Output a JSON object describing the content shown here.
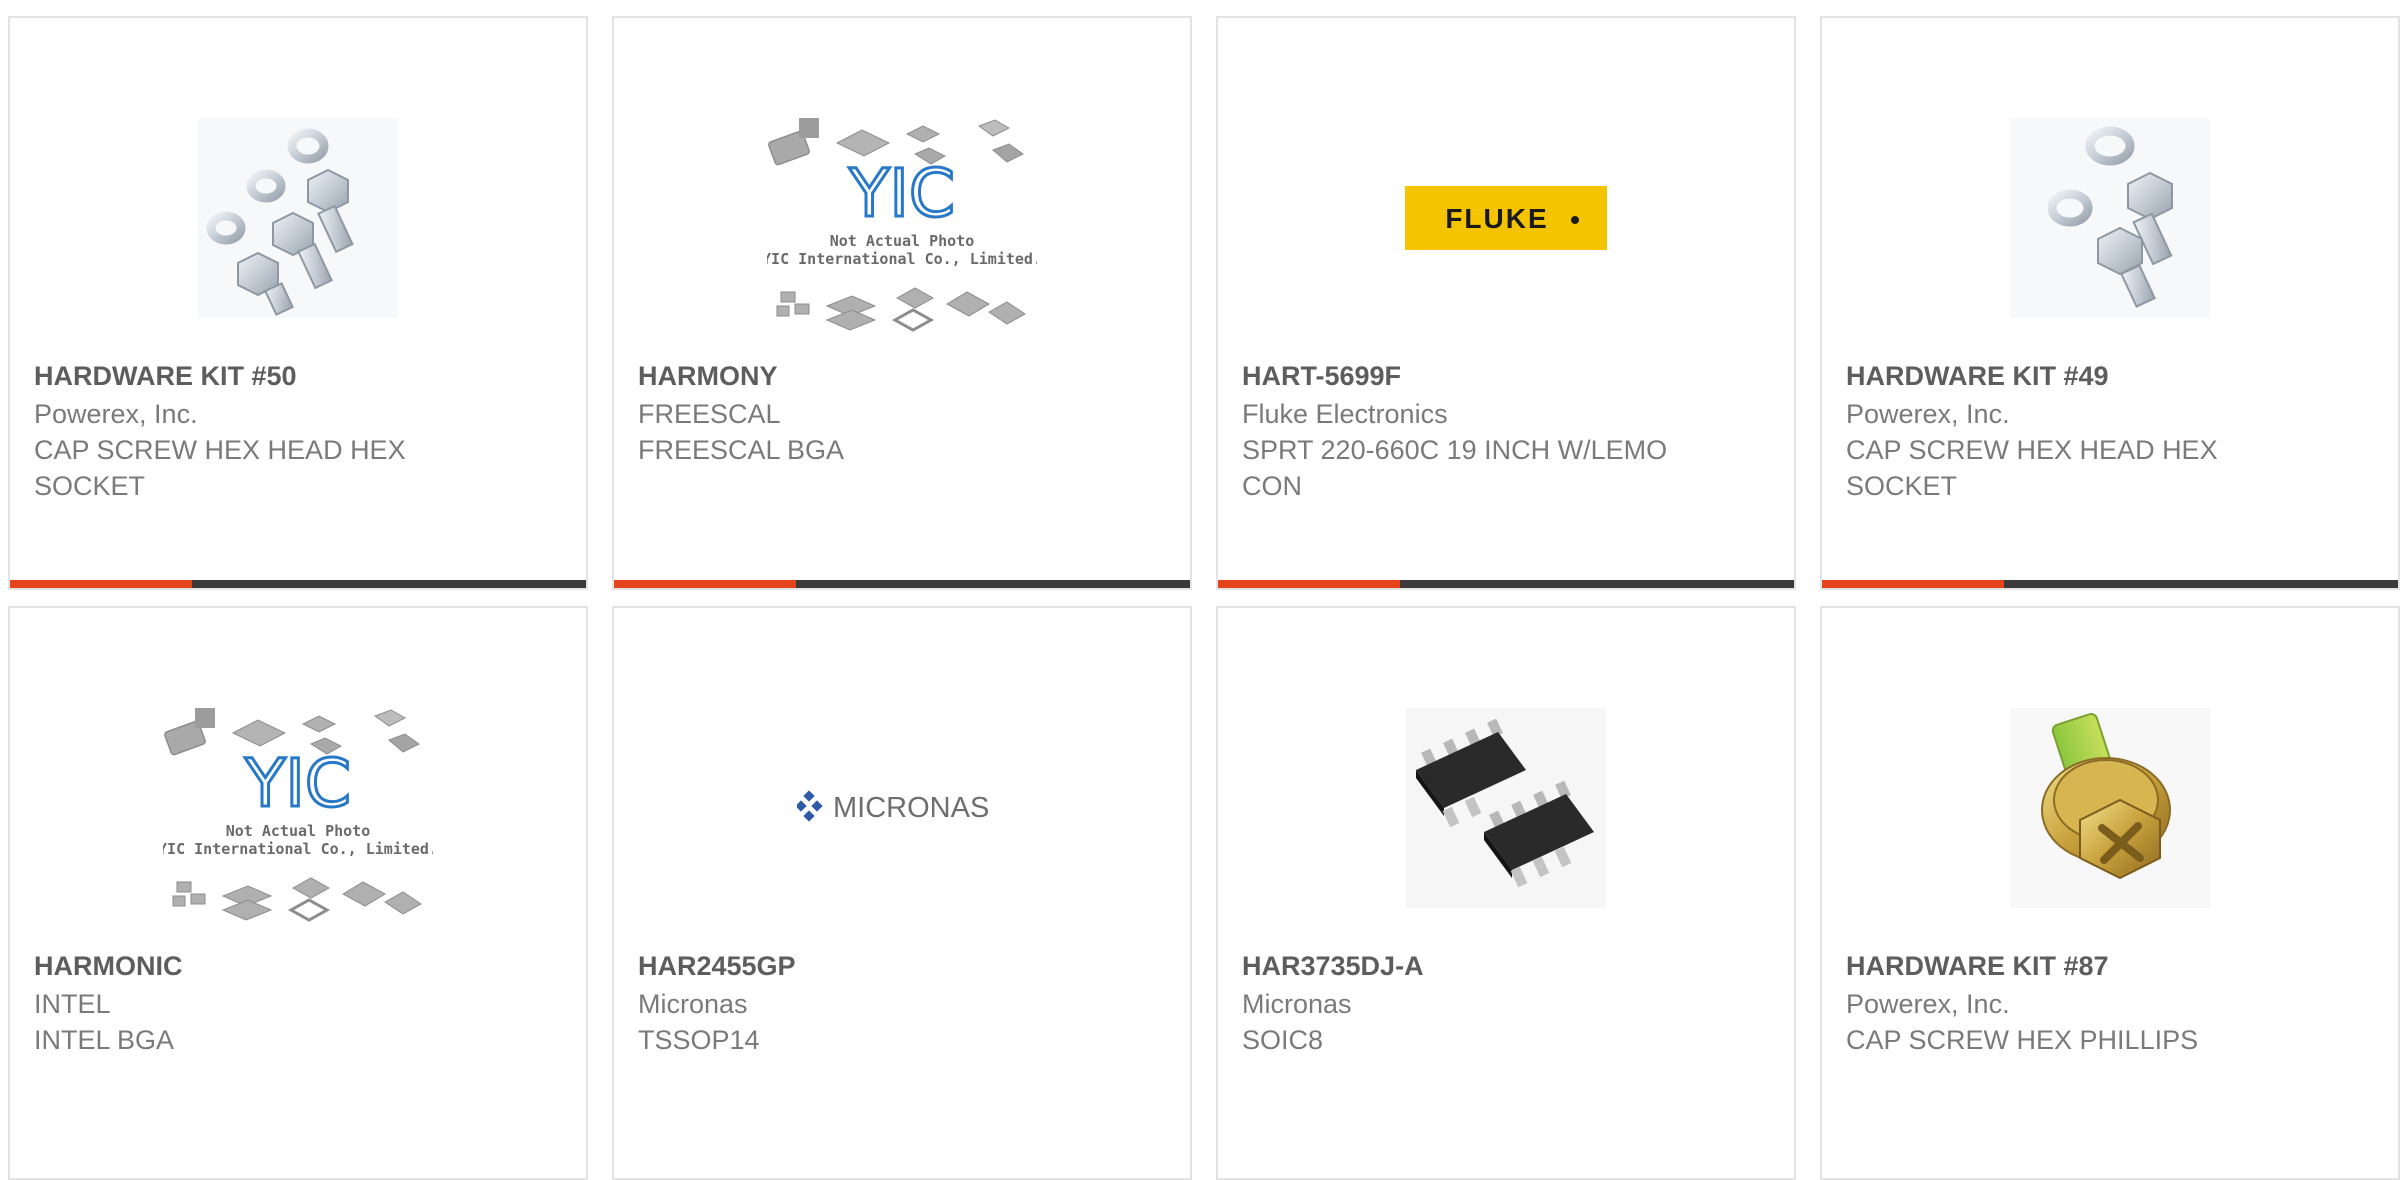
{
  "colors": {
    "accent": "#e5431b",
    "bar_dark": "#3a3a3a",
    "part_text": "#5d5d5d",
    "body_text": "#7a7a7a",
    "border": "#e3e3e3",
    "fluke_yellow": "#f5c400",
    "yic_blue": "#2878c8"
  },
  "placeholder": {
    "caption_line1": "Not Actual Photo",
    "caption_line2": "YIC International Co., Limited.",
    "logo_text": "YIC"
  },
  "logos": {
    "fluke": "FLUKE",
    "micronas": "MICRONAS"
  },
  "products": [
    {
      "part": "HARDWARE KIT #50",
      "manufacturer": "Powerex, Inc.",
      "description": "CAP SCREW HEX HEAD HEX SOCKET",
      "image": "hex-bolts-kit-icon"
    },
    {
      "part": "HARMONY",
      "manufacturer": "FREESCAL",
      "description": "FREESCAL BGA",
      "image": "yic-placeholder-icon"
    },
    {
      "part": "HART-5699F",
      "manufacturer": "Fluke Electronics",
      "description": "SPRT 220-660C 19 INCH W/LEMO CON",
      "image": "fluke-logo"
    },
    {
      "part": "HARDWARE KIT #49",
      "manufacturer": "Powerex, Inc.",
      "description": "CAP SCREW HEX HEAD HEX SOCKET",
      "image": "hex-bolts-kit-icon"
    },
    {
      "part": "HARMONIC",
      "manufacturer": "INTEL",
      "description": "INTEL BGA",
      "image": "yic-placeholder-icon"
    },
    {
      "part": "HAR2455GP",
      "manufacturer": "Micronas",
      "description": "TSSOP14",
      "image": "micronas-logo"
    },
    {
      "part": "HAR3735DJ-A",
      "manufacturer": "Micronas",
      "description": "SOIC8",
      "image": "soic8-chip-icon"
    },
    {
      "part": "HARDWARE KIT #87",
      "manufacturer": "Powerex, Inc.",
      "description": "CAP SCREW HEX PHILLIPS",
      "image": "phillips-screw-kit-icon"
    }
  ]
}
